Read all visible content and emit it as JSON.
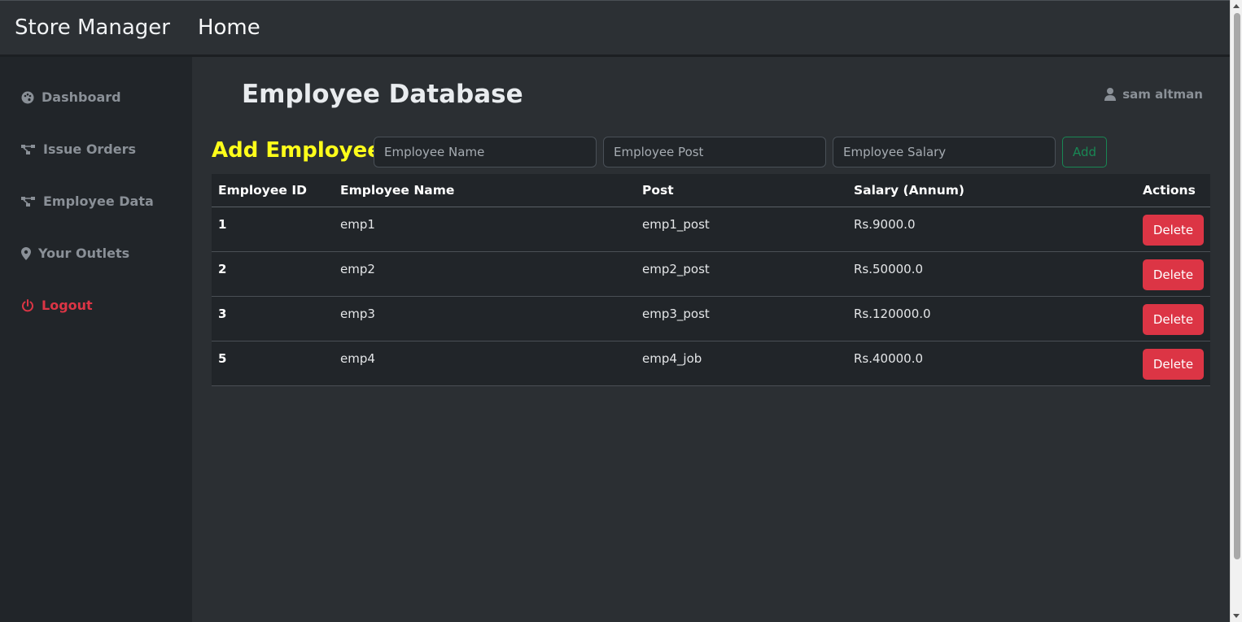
{
  "header": {
    "brand": "Store Manager",
    "home": "Home"
  },
  "sidebar": {
    "items": [
      {
        "label": "Dashboard",
        "icon": "palette-icon"
      },
      {
        "label": "Issue Orders",
        "icon": "diagram-icon"
      },
      {
        "label": "Employee Data",
        "icon": "diagram-icon"
      },
      {
        "label": "Your Outlets",
        "icon": "location-pin-icon"
      },
      {
        "label": "Logout",
        "icon": "power-icon"
      }
    ]
  },
  "main": {
    "title": "Employee Database",
    "user": "sam altman",
    "add_label": "Add Employee:",
    "inputs": {
      "name_placeholder": "Employee Name",
      "post_placeholder": "Employee Post",
      "salary_placeholder": "Employee Salary",
      "add_button": "Add"
    },
    "table": {
      "headers": [
        "Employee ID",
        "Employee Name",
        "Post",
        "Salary (Annum)",
        "Actions"
      ],
      "rows": [
        {
          "id": "1",
          "name": "emp1",
          "post": "emp1_post",
          "salary": "Rs.9000.0",
          "action": "Delete"
        },
        {
          "id": "2",
          "name": "emp2",
          "post": "emp2_post",
          "salary": "Rs.50000.0",
          "action": "Delete"
        },
        {
          "id": "3",
          "name": "emp3",
          "post": "emp3_post",
          "salary": "Rs.120000.0",
          "action": "Delete"
        },
        {
          "id": "5",
          "name": "emp4",
          "post": "emp4_job",
          "salary": "Rs.40000.0",
          "action": "Delete"
        }
      ]
    }
  },
  "colors": {
    "accent_yellow": "#ffff1a",
    "danger": "#dc3545",
    "success": "#198754"
  }
}
